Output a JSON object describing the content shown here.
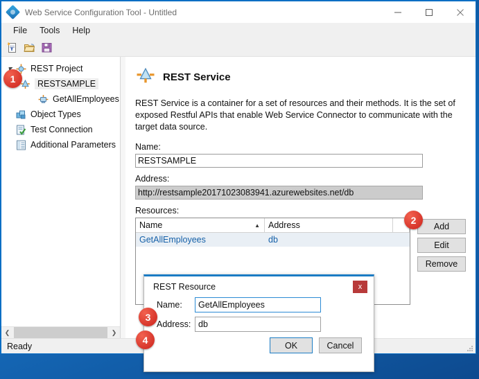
{
  "window": {
    "title": "Web Service Configuration Tool - Untitled",
    "app_icon": "diamond-app-icon",
    "controls": {
      "minimize": "minimize-icon",
      "maximize": "maximize-icon",
      "close": "close-icon"
    }
  },
  "menu": {
    "items": [
      {
        "label": "File"
      },
      {
        "label": "Tools"
      },
      {
        "label": "Help"
      }
    ]
  },
  "toolbar": {
    "buttons": [
      {
        "icon": "new-document-icon",
        "label": "New"
      },
      {
        "icon": "open-folder-icon",
        "label": "Open"
      },
      {
        "icon": "save-floppy-icon",
        "label": "Save"
      }
    ]
  },
  "sidebar": {
    "tree": [
      {
        "label": "REST Project",
        "icon": "rest-project-icon",
        "indent": 0,
        "expander": "expanded",
        "selected": false
      },
      {
        "label": "RESTSAMPLE",
        "icon": "rest-service-icon",
        "indent": 1,
        "expander": "none",
        "selected": true
      },
      {
        "label": "GetAllEmployees",
        "icon": "rest-resource-icon",
        "indent": 2,
        "expander": "none",
        "selected": false
      },
      {
        "label": "Object Types",
        "icon": "object-types-icon",
        "indent": 0,
        "expander": "none",
        "selected": false
      },
      {
        "label": "Test Connection",
        "icon": "test-connection-icon",
        "indent": 0,
        "expander": "none",
        "selected": false
      },
      {
        "label": "Additional Parameters",
        "icon": "additional-parameters-icon",
        "indent": 0,
        "expander": "none",
        "selected": false
      }
    ],
    "scrollbar": {
      "left_arrow": "chevron-left-icon",
      "right_arrow": "chevron-right-icon"
    }
  },
  "detail": {
    "icon": "rest-service-icon",
    "title": "REST Service",
    "description": "REST Service is a container for a set of resources and their methods. It is the set of exposed Restful APIs that enable Web Service Connector to communicate with the target data source.",
    "name_label": "Name:",
    "name_value": "RESTSAMPLE",
    "address_label": "Address:",
    "address_value": "http://restsample20171023083941.azurewebsites.net/db",
    "resources_label": "Resources:",
    "grid": {
      "columns": [
        {
          "label": "Name",
          "sorted": "ascending",
          "sort_icon": "sort-ascending-icon"
        },
        {
          "label": "Address",
          "sorted": "none",
          "sort_icon": ""
        }
      ],
      "rows": [
        {
          "name": "GetAllEmployees",
          "address": "db",
          "selected": true
        }
      ]
    },
    "buttons": [
      {
        "label": "Add"
      },
      {
        "label": "Edit"
      },
      {
        "label": "Remove"
      }
    ]
  },
  "status_bar": {
    "text": "Ready",
    "grip": "resize-grip-icon"
  },
  "dialog": {
    "title": "REST Resource",
    "close_label": "x",
    "close_icon": "close-icon",
    "name_label": "Name:",
    "name_value": "GetAllEmployees",
    "address_label": "Address:",
    "address_value": "db",
    "ok_label": "OK",
    "cancel_label": "Cancel"
  },
  "callouts": [
    {
      "number": "1"
    },
    {
      "number": "2"
    },
    {
      "number": "3"
    },
    {
      "number": "4"
    }
  ],
  "colors": {
    "accent_blue": "#0b6ec4",
    "badge_red": "#d6342a",
    "dialog_accent": "#1b7cc4",
    "close_button_red": "#b83a3a",
    "grid_selection": "#e9eff5",
    "readonly_field": "#cccccc"
  }
}
